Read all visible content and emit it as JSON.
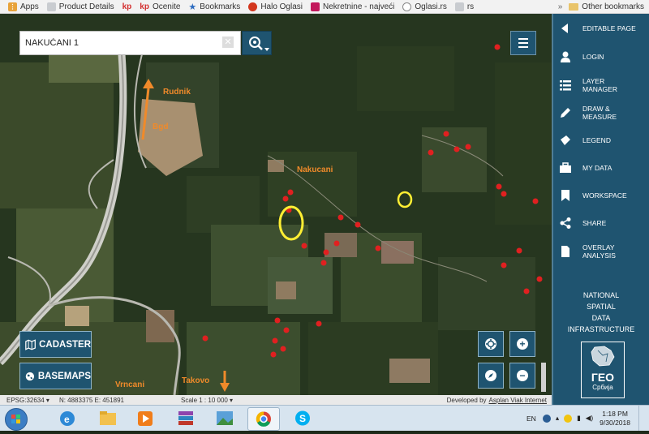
{
  "bookmarks": [
    {
      "label": "Apps",
      "icon": "apps-grid-icon",
      "color": "#e8a33b"
    },
    {
      "label": "Product Details",
      "icon": "page-icon",
      "color": "#9aa0a6"
    },
    {
      "label": "Ocenite",
      "icon": "kp-icon",
      "color": "#d32f2f",
      "prefix": "kp"
    },
    {
      "label": "Bookmarks",
      "icon": "star-icon",
      "color": "#2d6cc0"
    },
    {
      "label": "Halo Oglasi",
      "icon": "halo-oglasi-icon",
      "color": "#d3361d"
    },
    {
      "label": "Nekretnine - najveći",
      "icon": "nekretnine-icon",
      "color": "#c2185b"
    },
    {
      "label": "Oglasi.rs",
      "icon": "oglasi-icon",
      "color": "#9aa0a6"
    },
    {
      "label": "rs",
      "icon": "page-icon",
      "color": "#9aa0a6"
    }
  ],
  "bookmarks_first_kp": "kp",
  "other_bookmarks": "Other bookmarks",
  "search": {
    "value": "NAKUČANI 1"
  },
  "map_labels": {
    "rudnik": "Rudnik",
    "bgd": "Bgd",
    "nakucani": "Nakucani",
    "vrncani": "Vrncani",
    "takovo": "Takovo"
  },
  "buttons": {
    "cadaster": "CADASTER",
    "basemaps": "BASEMAPS"
  },
  "status": {
    "epsg": "EPSG:32634 ▾",
    "coords": "N: 4883375 E: 451891",
    "scale": "Scale 1 : 10 000 ▾",
    "developed_prefix": "Developed by",
    "developed_link": "Asplan Viak Internet"
  },
  "panel": {
    "items": [
      {
        "label": "EDITABLE PAGE",
        "icon": "arrow-left-icon"
      },
      {
        "label": "LOGIN",
        "icon": "user-icon"
      },
      {
        "label": "LAYER MANAGER",
        "icon": "list-icon"
      },
      {
        "label": "DRAW & MEASURE",
        "icon": "pencil-icon"
      },
      {
        "label": "LEGEND",
        "icon": "tag-icon"
      },
      {
        "label": "MY DATA",
        "icon": "briefcase-icon"
      },
      {
        "label": "WORKSPACE",
        "icon": "bookmark-icon"
      },
      {
        "label": "SHARE",
        "icon": "share-icon"
      },
      {
        "label": "OVERLAY ANALYSIS",
        "icon": "file-icon"
      }
    ],
    "nsdi": [
      "NATIONAL",
      "SPATIAL",
      "DATA",
      "INFRASTRUCTURE"
    ],
    "logo_text": "ГЕО",
    "logo_sub": "Србија"
  },
  "tray": {
    "lang": "EN",
    "time": "1:18 PM",
    "date": "9/30/2018"
  }
}
